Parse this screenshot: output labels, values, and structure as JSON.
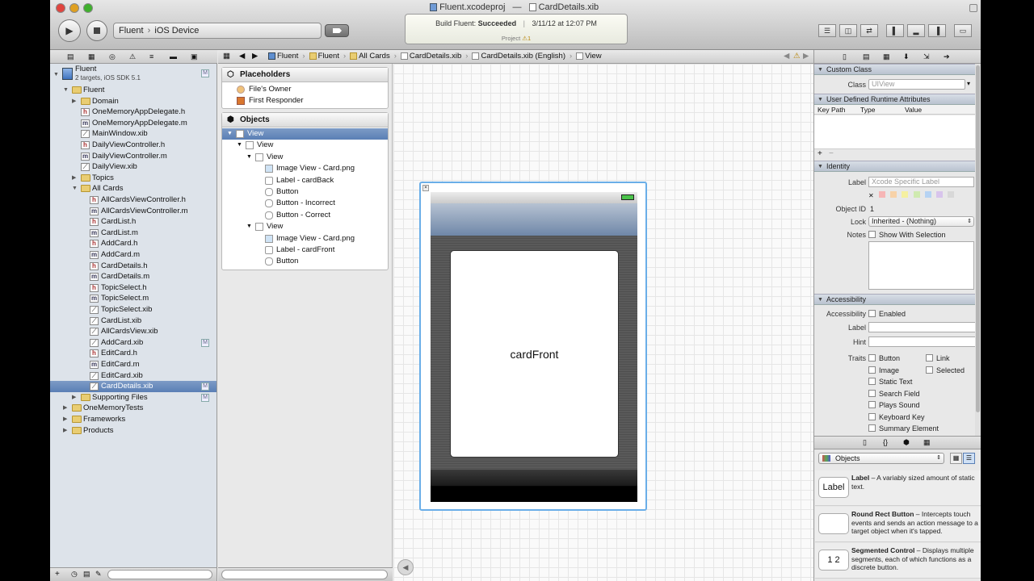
{
  "window": {
    "title_project": "Fluent.xcodeproj",
    "title_separator": "—",
    "title_file": "CardDetails.xib"
  },
  "toolbar": {
    "run_icon": "play-icon",
    "stop_icon": "stop-icon",
    "scheme": "Fluent",
    "scheme_sep": "›",
    "destination": "iOS Device",
    "status_prefix": "Build Fluent: ",
    "status_result": "Succeeded",
    "status_sep": "|",
    "status_time": "3/11/12 at 12:07 PM",
    "status_project": "Project",
    "status_warnings": "⚠1"
  },
  "jumpbar": {
    "items": [
      "Fluent",
      "Fluent",
      "All Cards",
      "CardDetails.xib",
      "CardDetails.xib (English)",
      "View"
    ]
  },
  "navigator": {
    "project": {
      "name": "Fluent",
      "subtitle": "2 targets, iOS SDK 5.1"
    },
    "items": [
      {
        "label": "Fluent",
        "kind": "folder",
        "depth": 1,
        "open": true
      },
      {
        "label": "Domain",
        "kind": "folder",
        "depth": 2,
        "open": false
      },
      {
        "label": "OneMemoryAppDelegate.h",
        "kind": "h",
        "depth": 2
      },
      {
        "label": "OneMemoryAppDelegate.m",
        "kind": "m",
        "depth": 2
      },
      {
        "label": "MainWindow.xib",
        "kind": "xib",
        "depth": 2
      },
      {
        "label": "DailyViewController.h",
        "kind": "h",
        "depth": 2
      },
      {
        "label": "DailyViewController.m",
        "kind": "m",
        "depth": 2
      },
      {
        "label": "DailyView.xib",
        "kind": "xib",
        "depth": 2
      },
      {
        "label": "Topics",
        "kind": "folder",
        "depth": 2,
        "open": false
      },
      {
        "label": "All Cards",
        "kind": "folder",
        "depth": 2,
        "open": true
      },
      {
        "label": "AllCardsViewController.h",
        "kind": "h",
        "depth": 3
      },
      {
        "label": "AllCardsViewController.m",
        "kind": "m",
        "depth": 3
      },
      {
        "label": "CardList.h",
        "kind": "h",
        "depth": 3
      },
      {
        "label": "CardList.m",
        "kind": "m",
        "depth": 3
      },
      {
        "label": "AddCard.h",
        "kind": "h",
        "depth": 3
      },
      {
        "label": "AddCard.m",
        "kind": "m",
        "depth": 3
      },
      {
        "label": "CardDetails.h",
        "kind": "h",
        "depth": 3
      },
      {
        "label": "CardDetails.m",
        "kind": "m",
        "depth": 3
      },
      {
        "label": "TopicSelect.h",
        "kind": "h",
        "depth": 3
      },
      {
        "label": "TopicSelect.m",
        "kind": "m",
        "depth": 3
      },
      {
        "label": "TopicSelect.xib",
        "kind": "xib",
        "depth": 3
      },
      {
        "label": "CardList.xib",
        "kind": "xib",
        "depth": 3
      },
      {
        "label": "AllCardsView.xib",
        "kind": "xib",
        "depth": 3
      },
      {
        "label": "AddCard.xib",
        "kind": "xib",
        "depth": 3,
        "badge": "M"
      },
      {
        "label": "EditCard.h",
        "kind": "h",
        "depth": 3
      },
      {
        "label": "EditCard.m",
        "kind": "m",
        "depth": 3
      },
      {
        "label": "EditCard.xib",
        "kind": "xib",
        "depth": 3
      },
      {
        "label": "CardDetails.xib",
        "kind": "xib",
        "depth": 3,
        "badge": "M",
        "selected": true
      },
      {
        "label": "Supporting Files",
        "kind": "folder",
        "depth": 2,
        "open": false,
        "badge": "M"
      },
      {
        "label": "OneMemoryTests",
        "kind": "folder",
        "depth": 1,
        "open": false
      },
      {
        "label": "Frameworks",
        "kind": "folder",
        "depth": 1,
        "open": false
      },
      {
        "label": "Products",
        "kind": "folder",
        "depth": 1,
        "open": false
      }
    ],
    "project_badge": "M"
  },
  "outline": {
    "placeholders_title": "Placeholders",
    "placeholders": [
      "File's Owner",
      "First Responder"
    ],
    "objects_title": "Objects",
    "objects": [
      {
        "label": "View",
        "depth": 0,
        "selected": true,
        "disclosure": true
      },
      {
        "label": "View",
        "depth": 1,
        "disclosure": true
      },
      {
        "label": "View",
        "depth": 2,
        "disclosure": true
      },
      {
        "label": "Image View - Card.png",
        "depth": 3
      },
      {
        "label": "Label - cardBack",
        "depth": 3
      },
      {
        "label": "Button",
        "depth": 3
      },
      {
        "label": "Button - Incorrect",
        "depth": 3
      },
      {
        "label": "Button - Correct",
        "depth": 3
      },
      {
        "label": "View",
        "depth": 2,
        "disclosure": true
      },
      {
        "label": "Image View - Card.png",
        "depth": 3
      },
      {
        "label": "Label - cardFront",
        "depth": 3
      },
      {
        "label": "Button",
        "depth": 3
      }
    ]
  },
  "canvas": {
    "card_label": "cardFront"
  },
  "inspector": {
    "custom_class": {
      "title": "Custom Class",
      "class_label": "Class",
      "class_placeholder": "UIView"
    },
    "runtime": {
      "title": "User Defined Runtime Attributes",
      "columns": [
        "Key Path",
        "Type",
        "Value"
      ],
      "add": "+",
      "remove": "−"
    },
    "identity": {
      "title": "Identity",
      "label_label": "Label",
      "label_placeholder": "Xcode Specific Label",
      "object_id_label": "Object ID",
      "object_id": "1",
      "lock_label": "Lock",
      "lock_value": "Inherited - (Nothing)",
      "notes_label": "Notes",
      "notes_check": "Show With Selection",
      "clear_icon": "✕"
    },
    "accessibility": {
      "title": "Accessibility",
      "acc_label": "Accessibility",
      "enabled": "Enabled",
      "label_label": "Label",
      "hint_label": "Hint",
      "traits_label": "Traits",
      "traits": [
        "Button",
        "Link",
        "Image",
        "Selected",
        "Static Text",
        "Search Field",
        "Plays Sound",
        "Keyboard Key",
        "Summary Element"
      ]
    }
  },
  "library": {
    "selector": "Objects",
    "items": [
      {
        "icon": "Label",
        "name": "Label",
        "desc": " – A variably sized amount of static text."
      },
      {
        "icon": "",
        "name": "Round Rect Button",
        "desc": " – Intercepts touch events and sends an action message to a target object when it's tapped."
      },
      {
        "icon": "1 2",
        "name": "Segmented Control",
        "desc": " – Displays multiple segments, each of which functions as a discrete button."
      }
    ]
  },
  "colors": {
    "selection": "#5a7fb5",
    "canvas_border": "#6aaee8",
    "folder": "#e9cd72"
  }
}
